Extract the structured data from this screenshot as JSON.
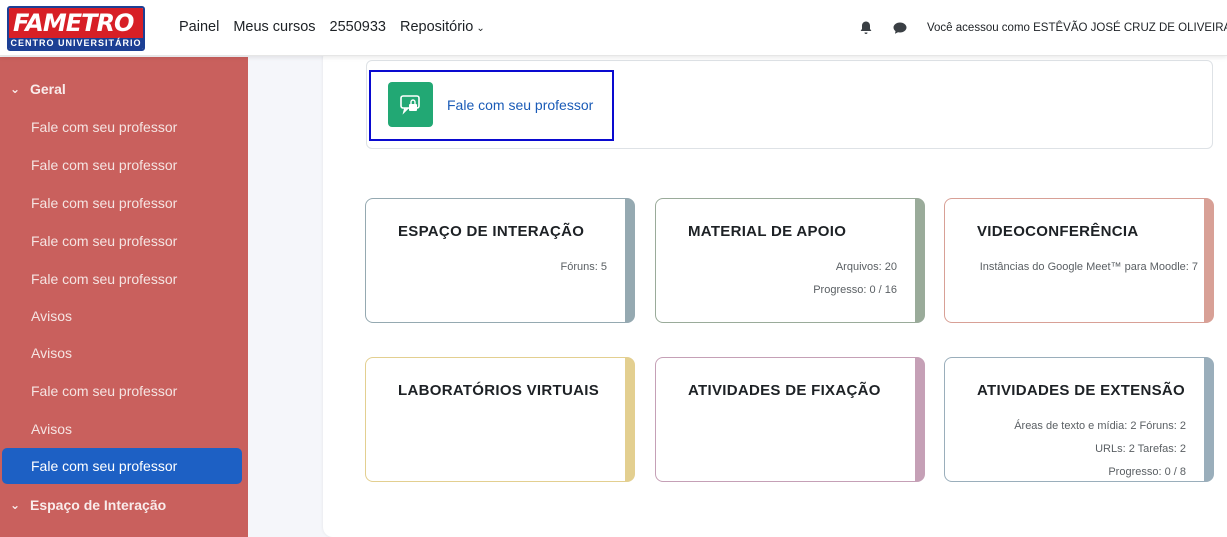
{
  "brand": {
    "name": "FAMETRO",
    "subtitle": "CENTRO UNIVERSITÁRIO",
    "red": "#d71f26",
    "blue": "#1c3f94"
  },
  "nav": {
    "links": [
      "Painel",
      "Meus cursos",
      "2550933",
      "Repositório"
    ],
    "user_text": "Você acessou como ESTÊVÃO JOSÉ CRUZ DE OLIVEIRA D",
    "icons": [
      "bell-icon",
      "chat-icon"
    ]
  },
  "sidebar": {
    "items": [
      {
        "label": "Geral",
        "type": "section"
      },
      {
        "label": "Fale com seu professor",
        "type": "item"
      },
      {
        "label": "Fale com seu professor",
        "type": "item"
      },
      {
        "label": "Fale com seu professor",
        "type": "item"
      },
      {
        "label": "Fale com seu professor",
        "type": "item"
      },
      {
        "label": "Fale com seu professor",
        "type": "item"
      },
      {
        "label": "Avisos",
        "type": "item"
      },
      {
        "label": "Avisos",
        "type": "item"
      },
      {
        "label": "Fale com seu professor",
        "type": "item"
      },
      {
        "label": "Avisos",
        "type": "item"
      },
      {
        "label": "Fale com seu professor",
        "type": "active"
      },
      {
        "label": "Espaço de Interação",
        "type": "section"
      }
    ],
    "bg_color": "#c9605d",
    "active_color": "#1d60c4"
  },
  "main": {
    "top_link": "Fale com seu professor",
    "top_icon_color": "#22a874",
    "cards": [
      {
        "title": "ESPAÇO DE INTERAÇÃO",
        "meta": [
          "Fóruns: 5"
        ],
        "accent": "#95a9b1"
      },
      {
        "title": "MATERIAL DE APOIO",
        "meta": [
          "Arquivos: 20",
          "Progresso: 0 / 16"
        ],
        "accent": "#9aab9a"
      },
      {
        "title": "VIDEOCONFERÊNCIA",
        "meta": [
          "Instâncias do Google Meet™ para Moodle: 7"
        ],
        "accent": "#d8a096"
      },
      {
        "title": "LABORATÓRIOS VIRTUAIS",
        "meta": [],
        "accent": "#e3cf90"
      },
      {
        "title": "ATIVIDADES DE FIXAÇÃO",
        "meta": [],
        "accent": "#c5a0b6"
      },
      {
        "title": "ATIVIDADES DE EXTENSÃO",
        "meta": [
          "Áreas de texto e mídia: 2   Fóruns: 2",
          "URLs: 2   Tarefas: 2",
          "Progresso: 0 / 8"
        ],
        "accent": "#9aaebb"
      }
    ]
  }
}
